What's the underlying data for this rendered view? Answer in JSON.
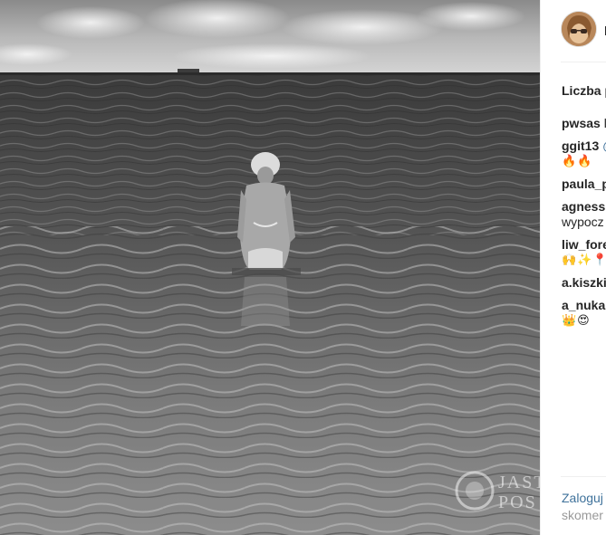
{
  "post": {
    "username": "l",
    "likes_text": "Liczba p",
    "comments": [
      {
        "user": "pwsas",
        "text": "l"
      },
      {
        "user": "ggit13",
        "mention": "@",
        "cont": "🔥🔥"
      },
      {
        "user": "paula_p",
        "text": ""
      },
      {
        "user": "agness",
        "text": "",
        "cont": "wypocz"
      },
      {
        "user": "liw_fore",
        "text": "",
        "cont": "🙌✨📍"
      },
      {
        "user": "a.kiszki",
        "text": ""
      },
      {
        "user": "a_nuka",
        "text": "",
        "cont": "👑😍"
      }
    ],
    "login": {
      "link": "Zaloguj",
      "rest": "skomer"
    }
  },
  "watermark": {
    "line1": "JAST",
    "line2": "POS"
  }
}
